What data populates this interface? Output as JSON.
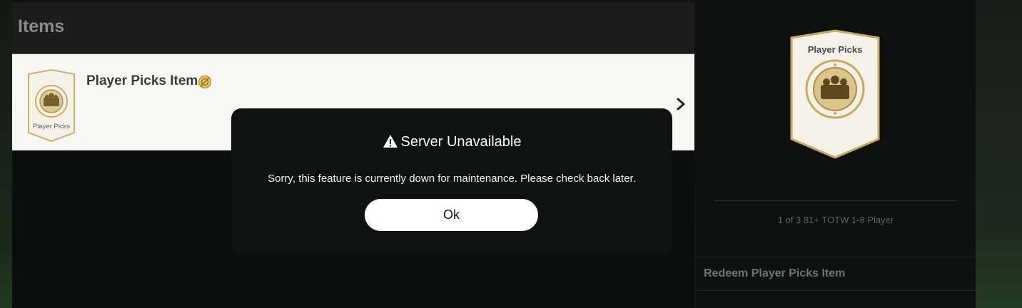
{
  "items_section": {
    "title": "Items",
    "item": {
      "name": "Player Picks Item",
      "thumb_label": "Player Picks",
      "untradeable_icon": "untradeable-icon",
      "chevron_icon": "chevron-right-icon"
    }
  },
  "side_panel": {
    "card_label": "Player Picks",
    "subtitle": "1 of 3 81+ TOTW 1-8 Player",
    "redeem_title": "Redeem Player Picks Item"
  },
  "modal": {
    "icon": "warning-icon",
    "title": "Server Unavailable",
    "message": "Sorry, this feature is currently down for maintenance. Please check back later.",
    "ok_label": "Ok"
  },
  "colors": {
    "card_gold": "#c9a95a",
    "card_bg": "#f4f1e8",
    "modal_bg": "#101211",
    "button_bg": "#ffffff"
  }
}
